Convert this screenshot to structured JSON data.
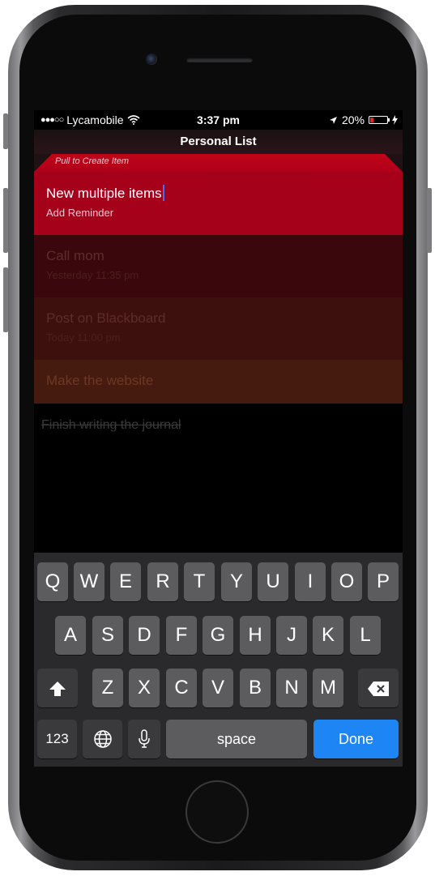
{
  "status_bar": {
    "signal": "●●●○○",
    "carrier": "Lycamobile",
    "wifi_icon": "wifi-icon",
    "time": "3:37 pm",
    "location_icon": "location-arrow-icon",
    "battery_percent": "20%",
    "battery_level": 0.2,
    "battery_color": "#e12326",
    "charging_icon": "bolt-icon"
  },
  "nav": {
    "title": "Personal List"
  },
  "pull_hint": "Pull to Create Item",
  "new_item": {
    "title": "New multiple items",
    "subtitle": "Add Reminder"
  },
  "items": [
    {
      "title": "Call mom",
      "subtitle": "Yesterday 11:35 pm"
    },
    {
      "title": "Post on Blackboard",
      "subtitle": "Today 11:00 pm"
    },
    {
      "title": "Make the website"
    }
  ],
  "completed": [
    {
      "title": "Finish writing the journal"
    }
  ],
  "keyboard": {
    "row1": [
      "Q",
      "W",
      "E",
      "R",
      "T",
      "Y",
      "U",
      "I",
      "O",
      "P"
    ],
    "row2": [
      "A",
      "S",
      "D",
      "F",
      "G",
      "H",
      "J",
      "K",
      "L"
    ],
    "row3": [
      "Z",
      "X",
      "C",
      "V",
      "B",
      "N",
      "M"
    ],
    "shift_icon": "shift-arrow-icon",
    "delete_icon": "backspace-icon",
    "numbers_label": "123",
    "globe_icon": "globe-icon",
    "mic_icon": "microphone-icon",
    "space_label": "space",
    "done_label": "Done",
    "accent_color": "#1e86f4"
  }
}
